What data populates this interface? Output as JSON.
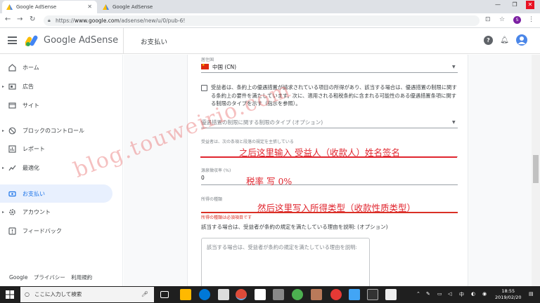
{
  "browser": {
    "tabs": [
      {
        "title": "Google AdSense",
        "active": true
      },
      {
        "title": "Google AdSense",
        "active": false
      }
    ],
    "url_scheme": "https://",
    "url_host": "www.google.com",
    "url_path": "/adsense/new/u/0/pub-6!",
    "profile_initial": "S"
  },
  "header": {
    "brand": "Google AdSense",
    "page_title": "お支払い",
    "avatar_initial": ""
  },
  "sidebar": {
    "items": [
      {
        "label": "ホーム",
        "icon": "home-icon",
        "expandable": false,
        "active": false
      },
      {
        "label": "広告",
        "icon": "ads-icon",
        "expandable": true,
        "active": false
      },
      {
        "label": "サイト",
        "icon": "sites-icon",
        "expandable": false,
        "active": false
      },
      {
        "label": "ブロックのコントロール",
        "icon": "block-icon",
        "expandable": true,
        "active": false
      },
      {
        "label": "レポート",
        "icon": "reports-icon",
        "expandable": false,
        "active": false
      },
      {
        "label": "最適化",
        "icon": "optimize-icon",
        "expandable": true,
        "active": false
      },
      {
        "label": "お支払い",
        "icon": "payments-icon",
        "expandable": false,
        "active": true
      },
      {
        "label": "アカウント",
        "icon": "account-gear-icon",
        "expandable": true,
        "active": false
      },
      {
        "label": "フィードバック",
        "icon": "feedback-icon",
        "expandable": false,
        "active": false
      }
    ],
    "footer": {
      "google": "Google",
      "privacy": "プライバシー",
      "terms": "利用規約"
    }
  },
  "form": {
    "country_label": "居住国",
    "country_value": "中国 (CN)",
    "treaty_checkbox_text": "受益者は、条約上の優遇措置が請求されている項目の所得があり、該当する場合は、優遇措置の制限に関する条約上の要件を満たしています。次に、適用される租税条約に含まれる可能性のある優遇措置条項に関する制限のタイプを示す（指示を参照）。",
    "limitation_type_placeholder": "優遇措置の制限に関する制限のタイプ (オプション)",
    "beneficiary_label": "受益者は、次の条項と段落の規定を主張している",
    "rate_label": "源泉徴収率 (%)",
    "rate_value": "0",
    "income_type_label": "所得の種類",
    "income_type_error": "所得の種類は必須項目です",
    "explanation_label": "該当する場合は、受益者が条約の規定を満たしている理由を説明: (オプション)",
    "explanation_placeholder": "該当する場合は、受益者が条約の規定を満たしている理由を説明:"
  },
  "annotations": {
    "beneficiary": "之后这里输入 受益人（收款人）姓名签名",
    "rate": "税率 写 0%",
    "income_type": "然后这里写入所得类型（收款性质类型）",
    "watermark": "blog.touweirio.com",
    "color": "#e0252e"
  },
  "taskbar": {
    "search_placeholder": "ここに入力して検索",
    "time": "18:55",
    "date": "2019/02/20",
    "ime": "中"
  }
}
